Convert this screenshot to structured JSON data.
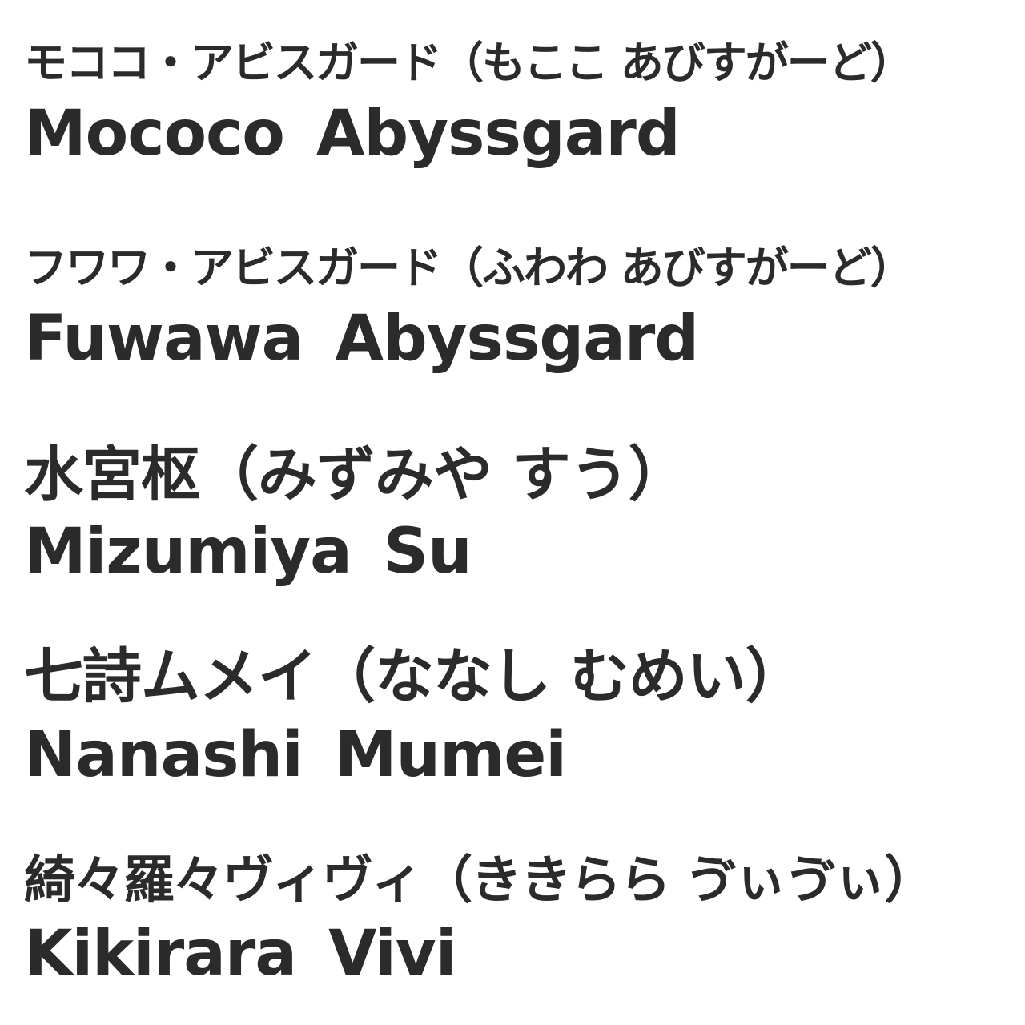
{
  "names": [
    {
      "kana": "モココ・アビスガード（もここ あびすがーど）",
      "roman": "Mococo  Abyssgard"
    },
    {
      "kana": "フワワ・アビスガード（ふわわ あびすがーど）",
      "roman": "Fuwawa  Abyssgard"
    },
    {
      "kana": "水宮枢（みずみや すう）",
      "roman": "Mizumiya  Su"
    },
    {
      "kana": "七詩ムメイ（ななし むめい）",
      "roman": "Nanashi  Mumei"
    },
    {
      "kana": "綺々羅々ヴィヴィ（ききらら ゔぃゔぃ）",
      "roman": "Kikirara  Vivi"
    }
  ],
  "colors": {
    "text": "#2b2b2b",
    "background": "#ffffff"
  }
}
